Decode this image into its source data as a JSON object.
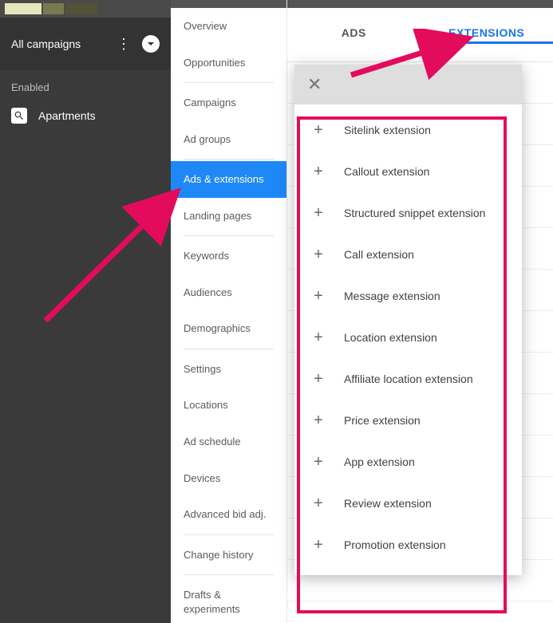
{
  "leftSidebar": {
    "title": "All campaigns",
    "statusLabel": "Enabled",
    "campaign": "Apartments"
  },
  "midNav": {
    "items": [
      {
        "label": "Overview",
        "sep": false
      },
      {
        "label": "Opportunities",
        "sep": true
      },
      {
        "label": "Campaigns",
        "sep": false
      },
      {
        "label": "Ad groups",
        "sep": true
      },
      {
        "label": "Ads & extensions",
        "sep": false,
        "active": true
      },
      {
        "label": "Landing pages",
        "sep": true
      },
      {
        "label": "Keywords",
        "sep": false
      },
      {
        "label": "Audiences",
        "sep": false
      },
      {
        "label": "Demographics",
        "sep": true
      },
      {
        "label": "Settings",
        "sep": false
      },
      {
        "label": "Locations",
        "sep": false
      },
      {
        "label": "Ad schedule",
        "sep": false
      },
      {
        "label": "Devices",
        "sep": false
      },
      {
        "label": "Advanced bid adj.",
        "sep": true
      },
      {
        "label": "Change history",
        "sep": true
      },
      {
        "label": "Drafts & experiments",
        "sep": false
      }
    ]
  },
  "tabs": {
    "ads": "ADS",
    "extensions": "EXTENSIONS"
  },
  "extensionMenu": {
    "items": [
      "Sitelink extension",
      "Callout extension",
      "Structured snippet extension",
      "Call extension",
      "Message extension",
      "Location extension",
      "Affiliate location extension",
      "Price extension",
      "App extension",
      "Review extension",
      "Promotion extension"
    ]
  }
}
